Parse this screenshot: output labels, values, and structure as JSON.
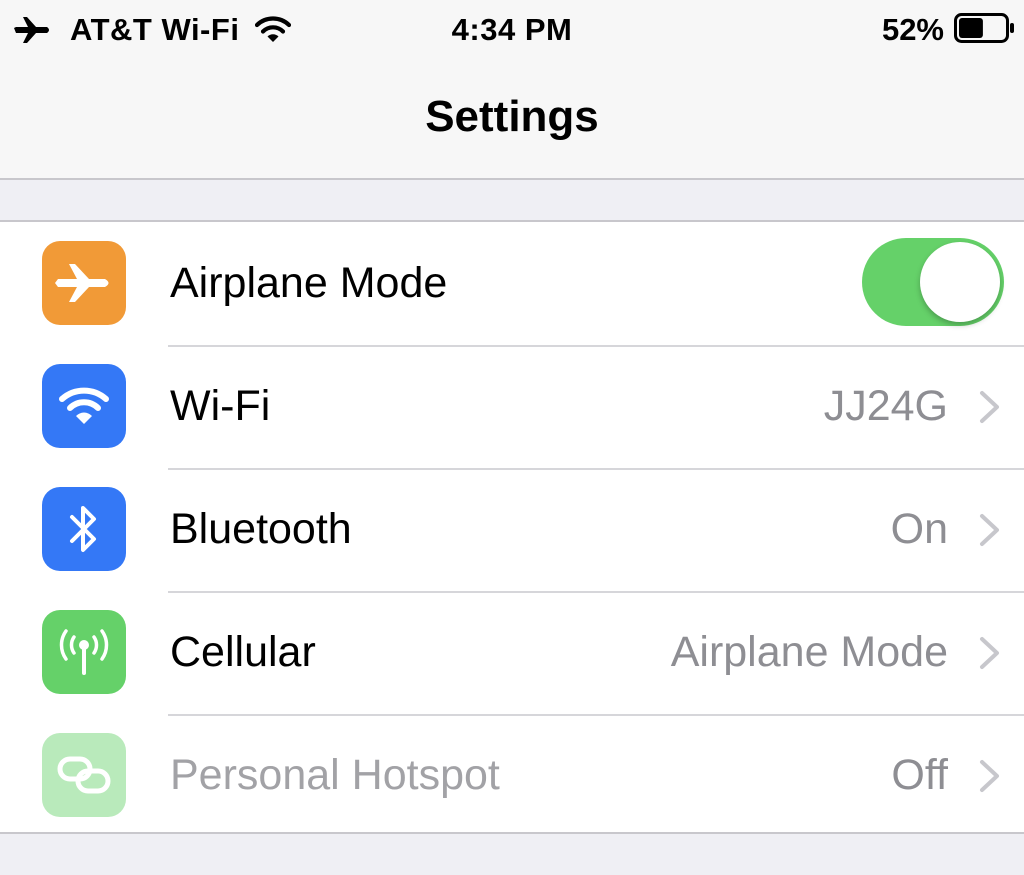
{
  "status_bar": {
    "carrier": "AT&T Wi-Fi",
    "time": "4:34 PM",
    "battery_percent": "52%",
    "battery_level": 0.52,
    "icons": [
      "airplane-icon",
      "wifi-icon",
      "battery-icon"
    ]
  },
  "nav": {
    "title": "Settings"
  },
  "settings": {
    "rows": [
      {
        "label": "Airplane Mode",
        "icon": "airplane-icon",
        "icon_color": "#f19a37",
        "toggle_on": true
      },
      {
        "label": "Wi-Fi",
        "value": "JJ24G",
        "icon": "wifi-icon",
        "icon_color": "#3478f6"
      },
      {
        "label": "Bluetooth",
        "value": "On",
        "icon": "bluetooth-icon",
        "icon_color": "#3478f6"
      },
      {
        "label": "Cellular",
        "value": "Airplane Mode",
        "icon": "antenna-icon",
        "icon_color": "#65d169"
      },
      {
        "label": "Personal Hotspot",
        "value": "Off",
        "icon": "hotspot-icon",
        "icon_color": "#65d169",
        "disabled": true
      }
    ]
  },
  "colors": {
    "toggle_on": "#65d169",
    "secondary_text": "#8e8e93",
    "group_background": "#efeff4"
  }
}
